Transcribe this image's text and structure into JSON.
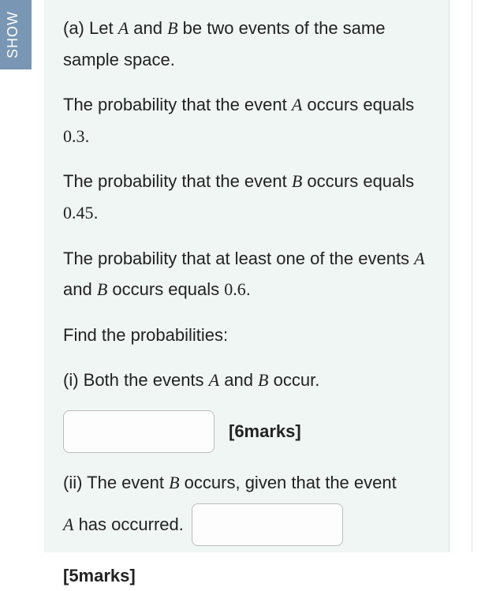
{
  "tab": {
    "label": "SHOW"
  },
  "question": {
    "part_a_intro_1": "(a) Let ",
    "var_A": "A",
    "and": " and ",
    "var_B": "B",
    "part_a_intro_2": " be two events of the same sample space.",
    "prob_a_1": "The probability that the event ",
    "prob_a_2": " occurs equals ",
    "prob_a_val": "0.3",
    "period": ".",
    "prob_b_1": "The probability that the event ",
    "prob_b_2": " occurs equals ",
    "prob_b_val": "0.45",
    "prob_union_1": "The probability that at least one of the events ",
    "prob_union_2": " occurs equals ",
    "prob_union_val": "0.6",
    "find": "Find the probabilities:",
    "part_i_1": "(i) Both the events ",
    "part_i_2": " occur.",
    "marks_i": "[6marks]",
    "part_ii_1": "(ii) The event ",
    "part_ii_2": " occurs, given that the event ",
    "part_ii_3": " has occurred. ",
    "marks_ii": "[5marks]"
  }
}
